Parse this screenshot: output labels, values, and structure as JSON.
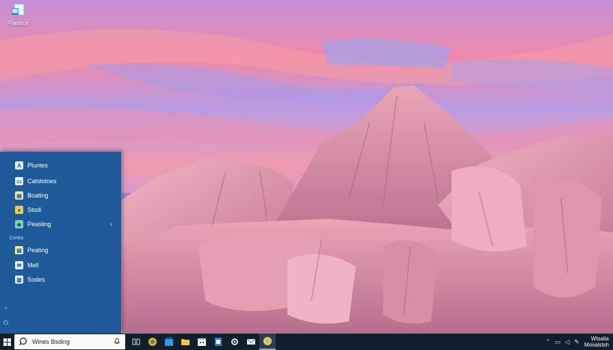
{
  "desktop": {
    "icon_label": "Plastics"
  },
  "start_menu": {
    "items": [
      {
        "label": "Pluntes",
        "icon": "app-icon",
        "color": "#e8eef7"
      },
      {
        "label": "Catstidoes",
        "icon": "app-icon",
        "color": "#e8eef7"
      },
      {
        "label": "Boating",
        "icon": "app-icon",
        "color": "#f4e7a8"
      },
      {
        "label": "Stodi",
        "icon": "app-icon",
        "color": "#f2c94c"
      },
      {
        "label": "Peasling",
        "icon": "app-icon",
        "color": "#7ed6a8",
        "has_submenu": true
      }
    ],
    "section_label": "Conbs",
    "section_items": [
      {
        "label": "Peating",
        "icon": "app-icon",
        "color": "#f4e7a8"
      },
      {
        "label": "Mell",
        "icon": "app-icon",
        "color": "#e8eef7"
      },
      {
        "label": "Sodes",
        "icon": "app-icon",
        "color": "#e8eef7"
      }
    ],
    "chevron": "›"
  },
  "taskbar": {
    "search_value": "Wines Bsding",
    "clock_line1": "Wtsalia",
    "clock_line2": "Mosalstsh"
  },
  "colors": {
    "start_menu_bg": "#1e5a9a",
    "taskbar_bg": "#0f1f2e"
  }
}
